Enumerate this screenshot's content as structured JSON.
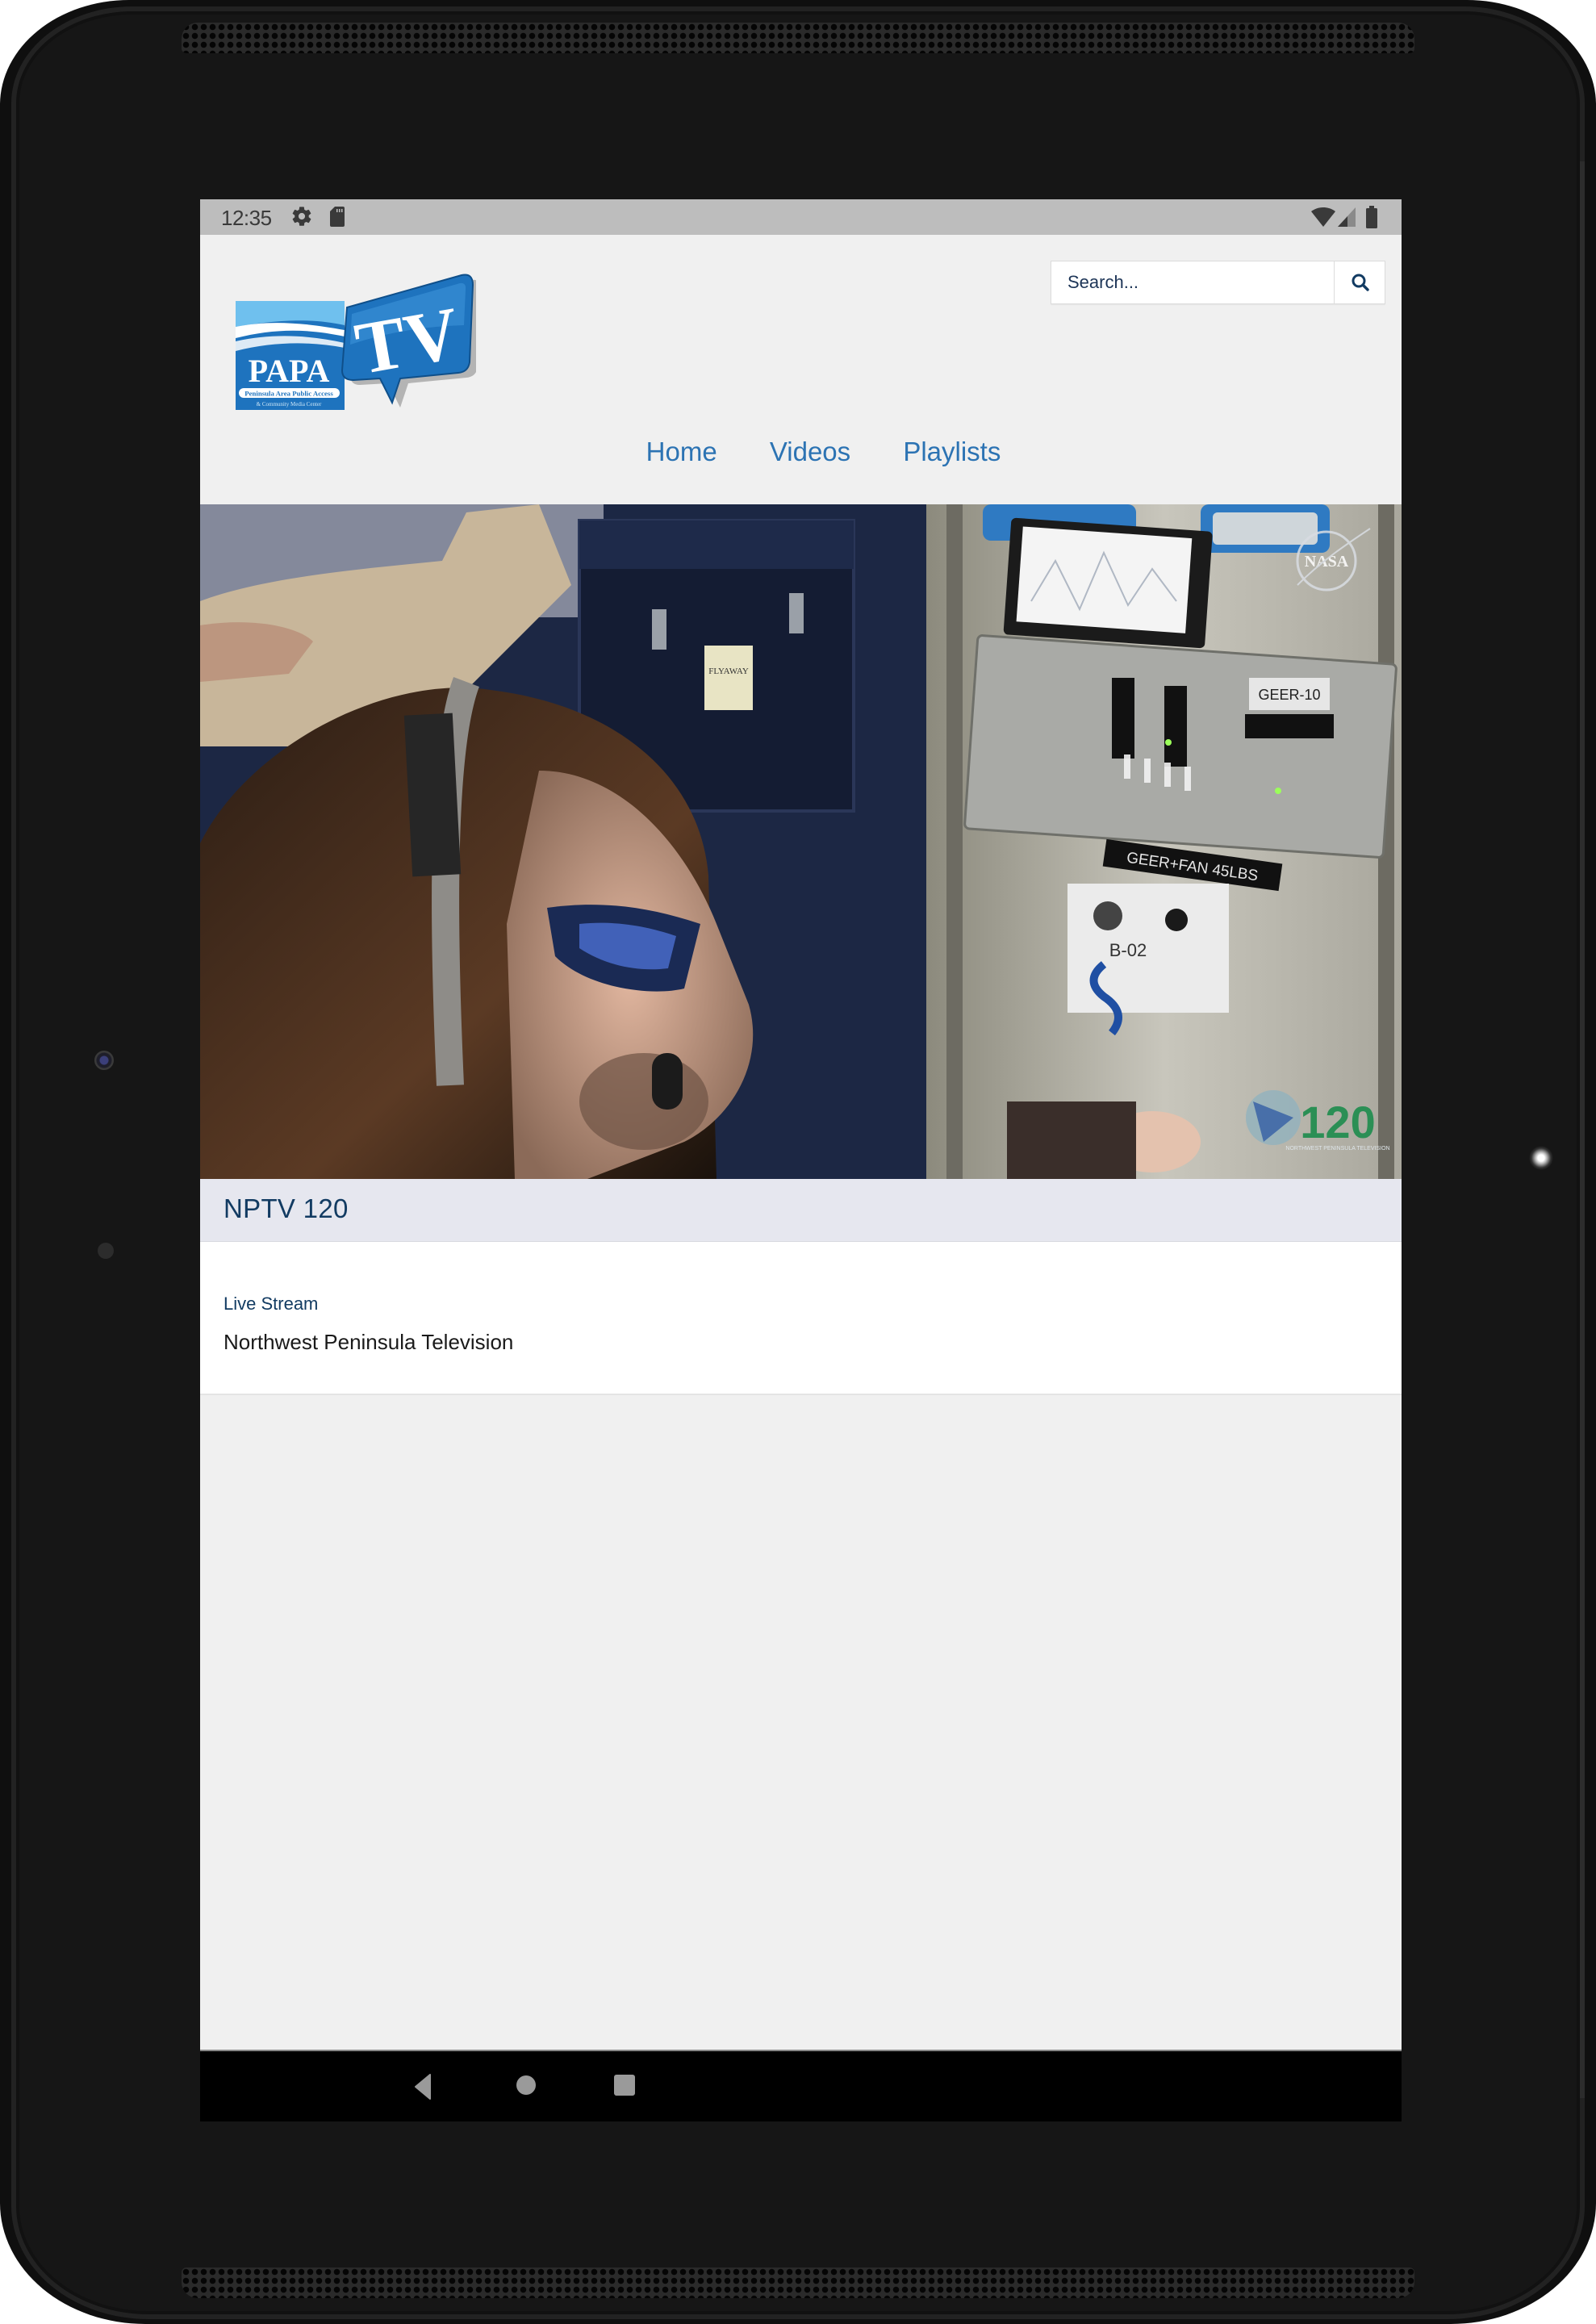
{
  "status_bar": {
    "time": "12:35",
    "left_icons": [
      "gear-icon",
      "sd-card-icon"
    ],
    "right_icons": [
      "wifi-icon",
      "cell-signal-icon",
      "battery-icon"
    ]
  },
  "header": {
    "logo": {
      "main_text": "PAPA",
      "tv_text": "TV",
      "tagline": "Peninsula Area Public Access",
      "subtagline": "& Community Media Center",
      "brand_blue": "#1e73be"
    },
    "search": {
      "placeholder": "Search...",
      "value": "",
      "button_icon": "search-icon"
    },
    "nav": [
      {
        "label": "Home"
      },
      {
        "label": "Videos"
      },
      {
        "label": "Playlists"
      }
    ],
    "nav_color": "#2c73b3"
  },
  "video": {
    "watermark_top": "NASA",
    "labels": [
      "FLYAWAY",
      "GEER-10",
      "GEER+FAN 45LBS",
      "B-02"
    ],
    "channel_bug": "120",
    "channel_bug_caption": "NORTHWEST PENINSULA TELEVISION"
  },
  "channel": {
    "title": "NPTV 120",
    "category": "Live Stream",
    "description": "Northwest Peninsula Television",
    "title_color": "#123b62"
  },
  "system_nav": {
    "buttons": [
      "back-icon",
      "home-icon",
      "recents-icon"
    ]
  }
}
